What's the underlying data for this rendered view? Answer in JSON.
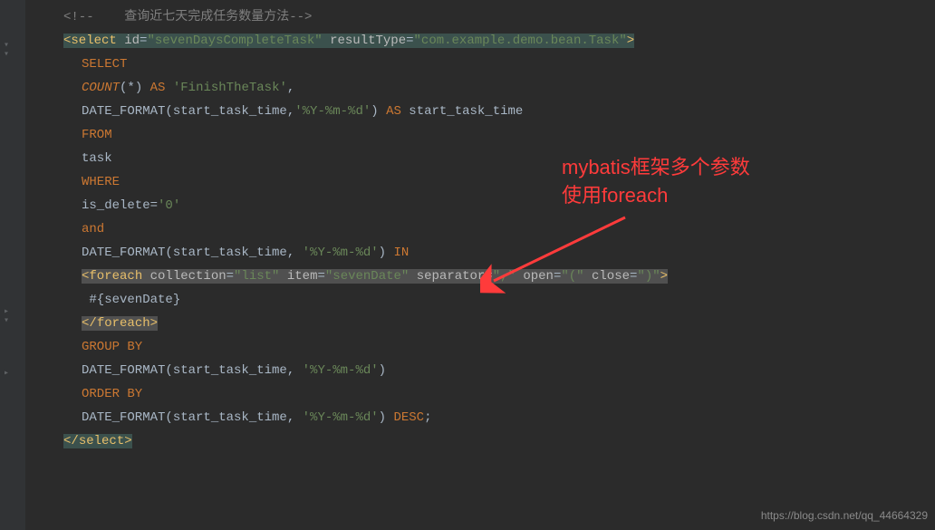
{
  "gutter": {
    "icons": [
      "▾",
      "▾",
      "▸",
      "▾",
      "▸"
    ]
  },
  "code": {
    "l1": {
      "comment_open": "<!--",
      "comment_text": "    查询近七天完成任务数量方法",
      "comment_close": "-->"
    },
    "l2": {
      "open": "<",
      "tag": "select",
      "a1n": " id",
      "eq": "=",
      "a1v": "\"sevenDaysCompleteTask\"",
      "a2n": " resultType",
      "a2v": "\"com.example.demo.bean.Task\"",
      "close": ">"
    },
    "l3": {
      "kw": "SELECT"
    },
    "l4": {
      "fn": "COUNT",
      "p1": "(",
      "star": "*",
      "p2": ") ",
      "as": "AS ",
      "str": "'FinishTheTask'",
      "comma": ","
    },
    "l5": {
      "fn": "DATE_FORMAT(start_task_time,",
      "str": "'%Y-%m-%d'",
      "p2": ") ",
      "as": "AS ",
      "col": "start_task_time"
    },
    "l6": {
      "kw": "FROM"
    },
    "l7": {
      "txt": "task"
    },
    "l8": {
      "kw": "WHERE"
    },
    "l9": {
      "txt": "is_delete=",
      "str": "'0'"
    },
    "l10": {
      "kw": "and"
    },
    "l11": {
      "fn": "DATE_FORMAT(start_task_time, ",
      "str": "'%Y-%m-%d'",
      "p2": ") ",
      "in": "IN"
    },
    "l12": {
      "open": "<",
      "tag": "foreach",
      "a1n": " collection",
      "eq": "=",
      "a1v": "\"list\"",
      "a2n": " item",
      "a2v": "\"sevenDate\"",
      "a3n": " separator",
      "a3v": "\",\"",
      "a4n": " open",
      "a4v": "\"(\"",
      "a5n": " close",
      "a5v": "\")\"",
      "close": ">"
    },
    "l13": {
      "txt": " #{sevenDate}"
    },
    "l14": {
      "open": "</",
      "tag": "foreach",
      "close": ">"
    },
    "l15": {
      "kw": "GROUP BY"
    },
    "l16": {
      "fn": "DATE_FORMAT(start_task_time, ",
      "str": "'%Y-%m-%d'",
      "p2": ")"
    },
    "l17": {
      "kw": "ORDER BY"
    },
    "l18": {
      "fn": "DATE_FORMAT(start_task_time, ",
      "str": "'%Y-%m-%d'",
      "p2": ") ",
      "desc": "DESC",
      "semi": ";"
    },
    "l19": {
      "open": "</",
      "tag": "select",
      "close": ">"
    }
  },
  "annotation": {
    "line1": "mybatis框架多个参数",
    "line2": "使用foreach"
  },
  "watermark": "https://blog.csdn.net/qq_44664329"
}
